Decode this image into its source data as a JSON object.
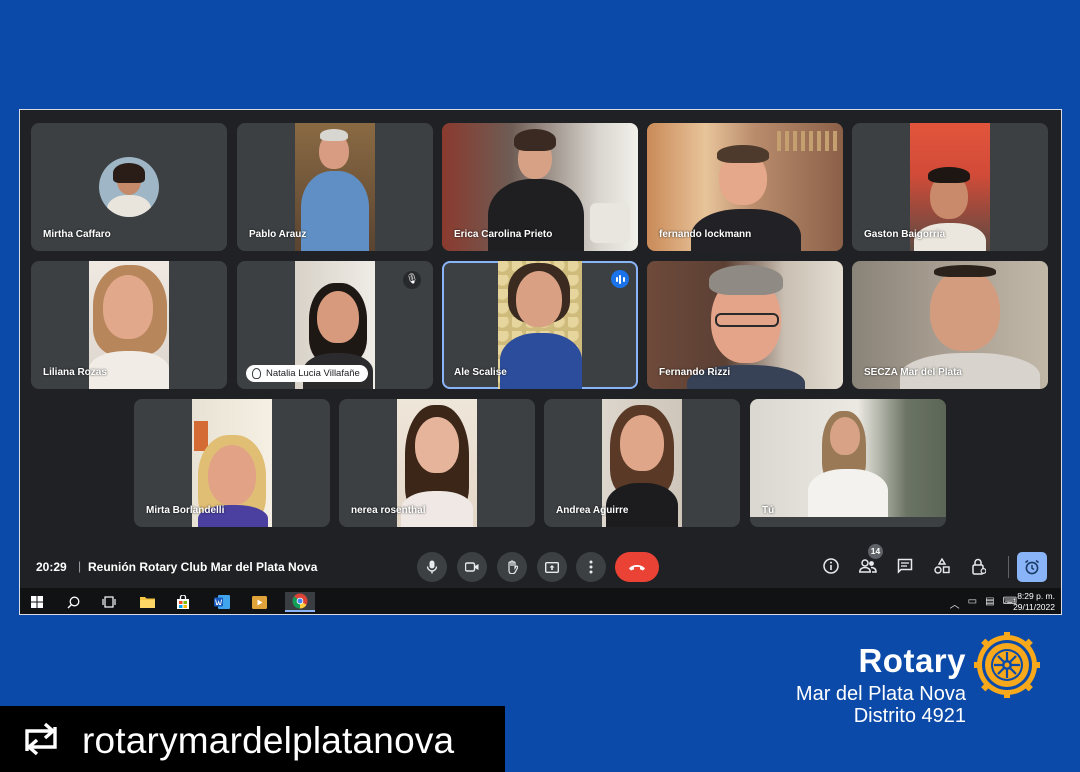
{
  "participants": [
    {
      "name": "Mirtha Caffaro"
    },
    {
      "name": "Pablo Arauz"
    },
    {
      "name": "Erica Carolina Prieto"
    },
    {
      "name": "fernando lockmann"
    },
    {
      "name": "Gaston Baigorria"
    },
    {
      "name": "Liliana Rozas"
    },
    {
      "name": "Natalia Lucia Villafañe"
    },
    {
      "name": "Ale Scalise"
    },
    {
      "name": "Fernando Rizzi"
    },
    {
      "name": "SECZA Mar del Plata"
    },
    {
      "name": "Mirta Borlandelli"
    },
    {
      "name": "nerea rosenthal"
    },
    {
      "name": "Andrea Aguirre"
    },
    {
      "name": "Tú"
    }
  ],
  "meeting": {
    "time": "20:29",
    "separator": "|",
    "title": "Reunión Rotary Club Mar del Plata Nova",
    "participant_count": "14"
  },
  "icons": {
    "mic": "microphone-icon",
    "camera": "camera-icon",
    "raise_hand": "hand-icon",
    "present": "present-screen-icon",
    "more": "more-options-icon",
    "end_call": "end-call-icon",
    "info": "info-icon",
    "people": "people-icon",
    "chat": "chat-icon",
    "activities": "activities-icon",
    "host_controls": "lock-icon",
    "timer": "alarm-icon"
  },
  "taskbar": {
    "clock_time": "8:29 p. m.",
    "clock_date": "29/11/2022"
  },
  "brand": {
    "word": "Rotary",
    "club": "Mar del Plata Nova",
    "district": "Distrito 4921"
  },
  "repost": {
    "handle": "rotarymardelplatanova"
  },
  "colors": {
    "background": "#0b4aa8",
    "meet_dark": "#202124",
    "tile": "#3c4043",
    "end_call": "#ea4335",
    "active_speaker": "#8ab4f8",
    "rotary_gold": "#f7a81b"
  }
}
